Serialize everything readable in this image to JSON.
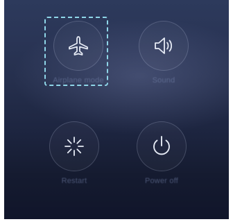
{
  "quick_actions": {
    "items": [
      {
        "id": "airplane",
        "label": "Airplane mode",
        "icon": "airplane-icon",
        "highlighted": true
      },
      {
        "id": "sound",
        "label": "Sound",
        "icon": "speaker-icon",
        "highlighted": false
      },
      {
        "id": "restart",
        "label": "Restart",
        "icon": "restart-icon",
        "highlighted": false
      },
      {
        "id": "power",
        "label": "Power off",
        "icon": "power-icon",
        "highlighted": false
      }
    ]
  },
  "colors": {
    "background_top": "#2d3a5c",
    "background_bottom": "#10152a",
    "icon_stroke": "#e6ebf5",
    "highlight_border": "#8fd6e8"
  }
}
